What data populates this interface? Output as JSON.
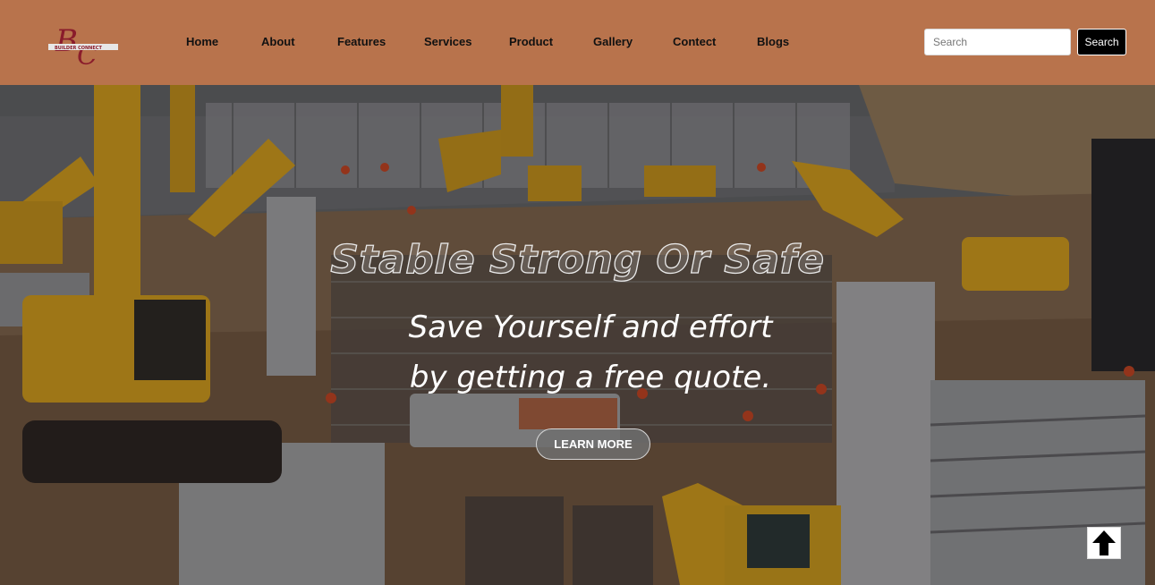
{
  "brand": {
    "logo_text": "BUILDER CONNECT",
    "logo_initials": "BC",
    "logo_color": "#8a1c2b"
  },
  "nav": {
    "items": [
      {
        "label": "Home"
      },
      {
        "label": "About"
      },
      {
        "label": "Features"
      },
      {
        "label": "Services"
      },
      {
        "label": "Product"
      },
      {
        "label": "Gallery"
      },
      {
        "label": "Contect"
      },
      {
        "label": "Blogs"
      }
    ]
  },
  "search": {
    "placeholder": "Search",
    "button_label": "Search"
  },
  "hero": {
    "title": "Stable Strong Or Safe",
    "subtitle": "Save Yourself and effort by getting a free quote.",
    "cta_label": "LEARN MORE"
  },
  "colors": {
    "navbar": "#b8734c",
    "accent": "#f2b51e"
  },
  "icons": {
    "back_to_top": "arrow-up-icon"
  }
}
